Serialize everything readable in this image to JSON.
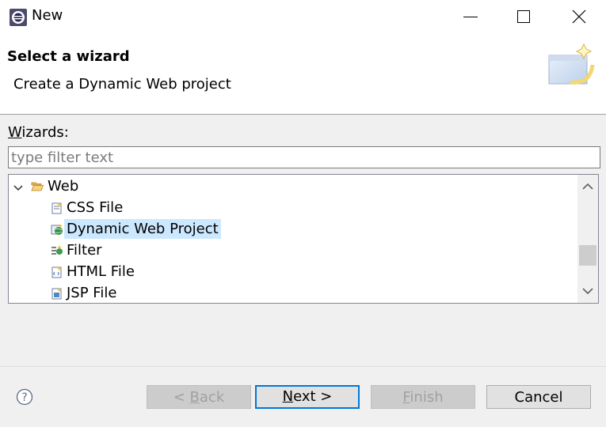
{
  "window": {
    "title": "New"
  },
  "header": {
    "title": "Select a wizard",
    "subtitle": "Create a Dynamic Web project"
  },
  "wizards": {
    "label_prefix": "W",
    "label_rest": "izards:",
    "filter_placeholder": "type filter text",
    "filter_value": ""
  },
  "tree": {
    "category": {
      "label": "Web",
      "expanded": true
    },
    "items": [
      {
        "label": "CSS File",
        "icon": "css-file-icon"
      },
      {
        "label": "Dynamic Web Project",
        "icon": "web-project-icon",
        "selected": true
      },
      {
        "label": "Filter",
        "icon": "filter-icon"
      },
      {
        "label": "HTML File",
        "icon": "html-file-icon"
      },
      {
        "label": "JSP File",
        "icon": "jsp-file-icon"
      }
    ]
  },
  "buttons": {
    "back": {
      "pre": "< ",
      "mnemonic": "B",
      "post": "ack",
      "enabled": false
    },
    "next": {
      "mnemonic": "N",
      "post": "ext >",
      "enabled": true
    },
    "finish": {
      "mnemonic": "F",
      "post": "inish",
      "enabled": false
    },
    "cancel": {
      "label": "Cancel",
      "enabled": true
    }
  },
  "colors": {
    "selection": "#cce8ff",
    "default_button_border": "#0078d7"
  }
}
